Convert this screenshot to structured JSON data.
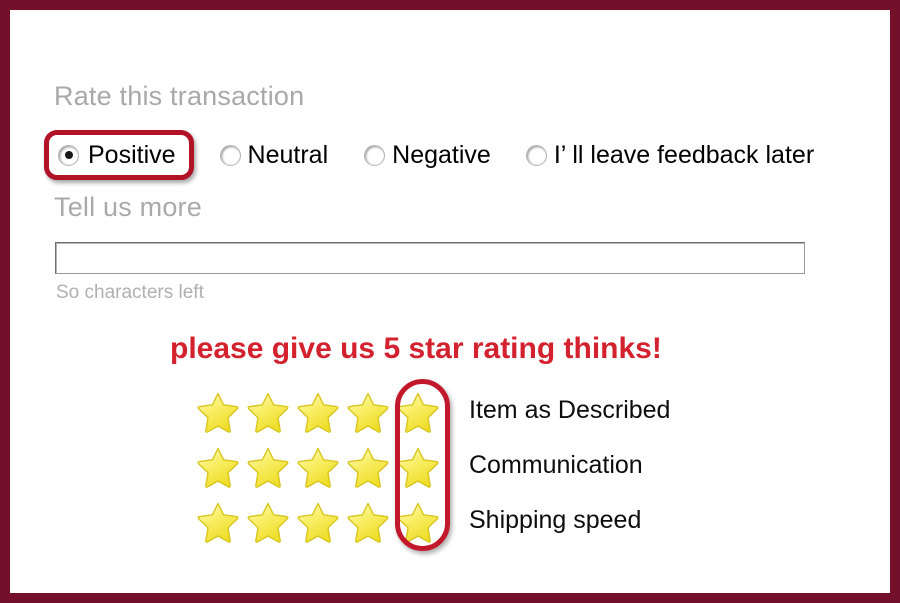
{
  "frame": {
    "border_color": "#74102a",
    "background": "#ffffff"
  },
  "rate_section": {
    "heading": "Rate this transaction",
    "options": [
      {
        "label": "Positive",
        "selected": true
      },
      {
        "label": "Neutral",
        "selected": false
      },
      {
        "label": "Negative",
        "selected": false
      },
      {
        "label": "I’  ll leave feedback later",
        "selected": false
      }
    ],
    "highlight_color": "#b21226"
  },
  "tell_section": {
    "heading": "Tell us more",
    "input_value": "",
    "input_placeholder": "",
    "char_counter": "So characters left"
  },
  "promo": {
    "headline": "please give us 5 star rating thinks!",
    "color": "#d4212e"
  },
  "ratings": {
    "star_count": 5,
    "highlighted_star_index": 5,
    "highlight_color": "#c2182b",
    "star_color": "#f7e63f",
    "rows": [
      {
        "label": "Item as Described",
        "value": 5
      },
      {
        "label": "Communication",
        "value": 5
      },
      {
        "label": "Shipping speed",
        "value": 5
      }
    ]
  }
}
